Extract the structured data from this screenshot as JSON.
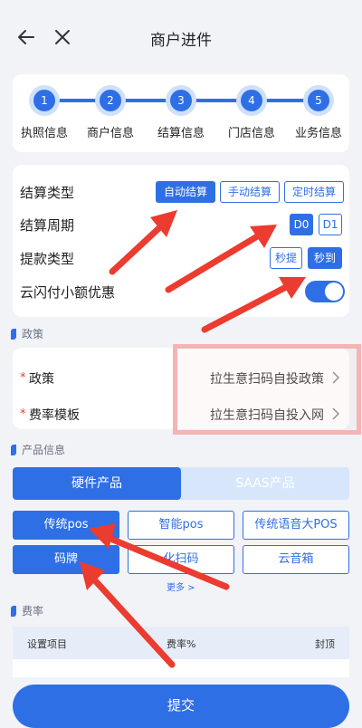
{
  "nav": {
    "title": "商户进件"
  },
  "steps": [
    {
      "num": "1",
      "label": "执照信息"
    },
    {
      "num": "2",
      "label": "商户信息"
    },
    {
      "num": "3",
      "label": "结算信息"
    },
    {
      "num": "4",
      "label": "门店信息"
    },
    {
      "num": "5",
      "label": "业务信息"
    }
  ],
  "settlement": {
    "type_label": "结算类型",
    "type_options": [
      "自动结算",
      "手动结算",
      "定时结算"
    ],
    "type_selected": "自动结算",
    "cycle_label": "结算周期",
    "cycle_options": [
      "D0",
      "D1"
    ],
    "cycle_selected": "D0",
    "withdraw_label": "提款类型",
    "withdraw_options": [
      "秒提",
      "秒到"
    ],
    "withdraw_selected": "秒到",
    "yunshanfu_label": "云闪付小额优惠",
    "yunshanfu_on": true
  },
  "policy_section": {
    "title": "政策",
    "rows": [
      {
        "name": "政策",
        "value": "拉生意扫码自投政策"
      },
      {
        "name": "费率模板",
        "value": "拉生意扫码自投入网"
      }
    ]
  },
  "product_section": {
    "title": "产品信息",
    "tabs": [
      "硬件产品",
      "SAAS产品"
    ],
    "active_tab": "硬件产品",
    "products": [
      "传统pos",
      "智能pos",
      "传统语音大POS",
      "码牌",
      "化扫码",
      "云音箱"
    ],
    "selected": [
      "传统pos",
      "码牌"
    ],
    "more": "更多 >"
  },
  "rate_section": {
    "title": "费率",
    "columns": [
      "设置项目",
      "费率%",
      "封顶"
    ]
  },
  "submit_label": "提交",
  "colors": {
    "primary": "#2f6fe6",
    "annotation_red": "#ec3b2f",
    "highlight": "#f3b4b4"
  }
}
